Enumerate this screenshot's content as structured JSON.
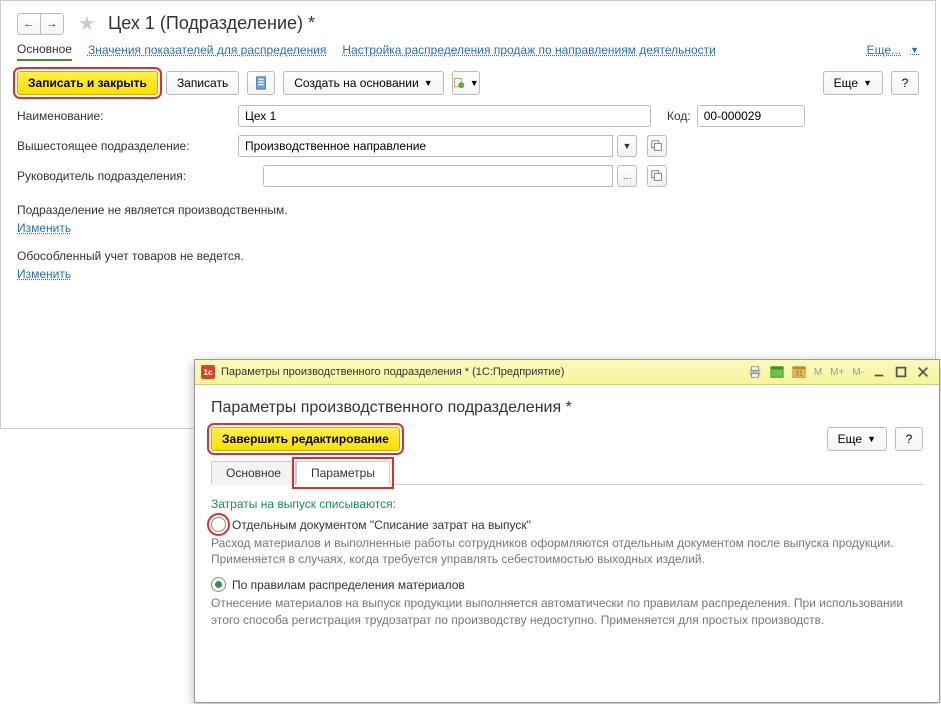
{
  "header": {
    "title": "Цех 1 (Подразделение) *"
  },
  "nav_tabs": {
    "main": "Основное",
    "values": "Значения показателей для распределения",
    "setup": "Настройка распределения продаж по направлениям деятельности",
    "more": "Еще..."
  },
  "toolbar": {
    "save_close": "Записать и закрыть",
    "save": "Записать",
    "create_based": "Создать на основании",
    "more": "Еще",
    "help": "?"
  },
  "form": {
    "name_label": "Наименование:",
    "name_value": "Цех 1",
    "code_label": "Код:",
    "code_value": "00-000029",
    "parent_label": "Вышестоящее подразделение:",
    "parent_value": "Производственное направление",
    "head_label": "Руководитель подразделения:",
    "head_value": ""
  },
  "notes": {
    "not_production": "Подразделение не является производственным.",
    "change": "Изменить",
    "separate_acc": "Обособленный учет товаров не ведется."
  },
  "modal": {
    "titlebar": "Параметры производственного подразделения * (1С:Предприятие)",
    "title": "Параметры производственного подразделения *",
    "finish": "Завершить редактирование",
    "more": "Еще",
    "help": "?",
    "tabs": {
      "main": "Основное",
      "params": "Параметры"
    },
    "section": "Затраты на выпуск списываются:",
    "opt1": "Отдельным документом \"Списание затрат на выпуск\"",
    "opt1_hint": "Расход материалов и выполненные работы сотрудников оформляются отдельным документом после выпуска продукции. Применяется в случаях, когда требуется управлять себестоимостью выходных изделий.",
    "opt2": "По правилам распределения материалов",
    "opt2_hint": "Отнесение материалов на выпуск продукции выполняется автоматически по правилам распределения. При использовании этого способа регистрация трудозатрат по производству недоступно. Применяется для простых производств."
  }
}
